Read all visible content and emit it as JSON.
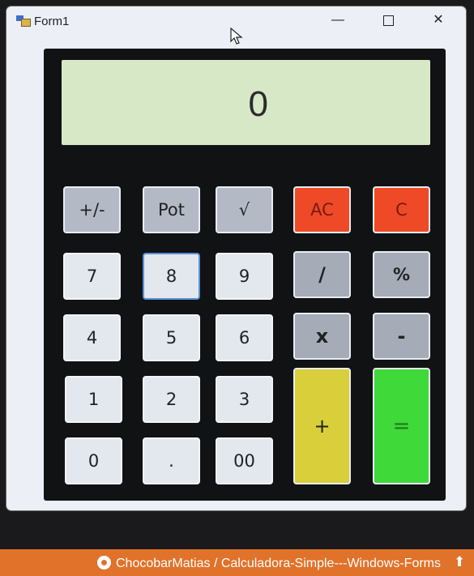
{
  "window": {
    "title": "Form1",
    "controls": {
      "minimize": "—",
      "maximize": "",
      "close": "✕"
    }
  },
  "display": {
    "value": "0"
  },
  "keys": {
    "sign": "+/-",
    "pot": "Pot",
    "sqrt": "√",
    "ac": "AC",
    "c": "C",
    "seven": "7",
    "eight": "8",
    "nine": "9",
    "divide": "/",
    "percent": "%",
    "four": "4",
    "five": "5",
    "six": "6",
    "multiply": "x",
    "minus": "-",
    "one": "1",
    "two": "2",
    "three": "3",
    "plus": "+",
    "equals": "=",
    "zero": "0",
    "dot": ".",
    "double_zero": "00"
  },
  "footer": {
    "link": "ChocobarMatias / Calculadora-Simple---Windows-Forms",
    "scroll_top": "⬆"
  },
  "colors": {
    "display_bg": "#d7e8c7",
    "clear_keys": "#ef4a27",
    "plus_key": "#d9cf3a",
    "equals_key": "#3fd93a",
    "footer_bg": "#e0722a"
  }
}
